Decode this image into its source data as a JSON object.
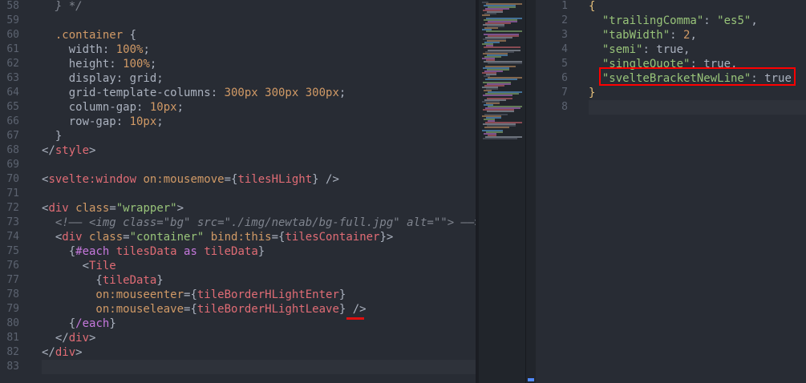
{
  "left_editor": {
    "lines": [
      {
        "n": "58",
        "segments": [
          {
            "t": "  } */",
            "c": "t-comment"
          }
        ]
      },
      {
        "n": "59",
        "segments": []
      },
      {
        "n": "60",
        "segments": [
          {
            "t": "  .container",
            "c": "t-cls"
          },
          {
            "t": " {",
            "c": "t-punct"
          }
        ]
      },
      {
        "n": "61",
        "segments": [
          {
            "t": "    width: ",
            "c": "t-prop"
          },
          {
            "t": "100%",
            "c": "t-num"
          },
          {
            "t": ";",
            "c": "t-punct"
          }
        ]
      },
      {
        "n": "62",
        "segments": [
          {
            "t": "    height: ",
            "c": "t-prop"
          },
          {
            "t": "100%",
            "c": "t-num"
          },
          {
            "t": ";",
            "c": "t-punct"
          }
        ]
      },
      {
        "n": "63",
        "segments": [
          {
            "t": "    display: grid;",
            "c": "t-prop"
          }
        ]
      },
      {
        "n": "64",
        "segments": [
          {
            "t": "    grid-template-columns: ",
            "c": "t-prop"
          },
          {
            "t": "300px 300px 300px",
            "c": "t-num"
          },
          {
            "t": ";",
            "c": "t-punct"
          }
        ]
      },
      {
        "n": "65",
        "segments": [
          {
            "t": "    column-gap: ",
            "c": "t-prop"
          },
          {
            "t": "10px",
            "c": "t-num"
          },
          {
            "t": ";",
            "c": "t-punct"
          }
        ]
      },
      {
        "n": "66",
        "segments": [
          {
            "t": "    row-gap: ",
            "c": "t-prop"
          },
          {
            "t": "10px",
            "c": "t-num"
          },
          {
            "t": ";",
            "c": "t-punct"
          }
        ]
      },
      {
        "n": "67",
        "segments": [
          {
            "t": "  }",
            "c": "t-punct"
          }
        ]
      },
      {
        "n": "68",
        "segments": [
          {
            "t": "</",
            "c": "t-punct"
          },
          {
            "t": "style",
            "c": "t-tag"
          },
          {
            "t": ">",
            "c": "t-punct"
          }
        ]
      },
      {
        "n": "69",
        "segments": []
      },
      {
        "n": "70",
        "segments": [
          {
            "t": "<",
            "c": "t-punct"
          },
          {
            "t": "svelte:window",
            "c": "t-tag"
          },
          {
            "t": " on:mousemove",
            "c": "t-attr"
          },
          {
            "t": "={",
            "c": "t-punct"
          },
          {
            "t": "tilesHLight",
            "c": "t-var"
          },
          {
            "t": "} />",
            "c": "t-punct"
          }
        ]
      },
      {
        "n": "71",
        "segments": []
      },
      {
        "n": "72",
        "segments": [
          {
            "t": "<",
            "c": "t-punct"
          },
          {
            "t": "div",
            "c": "t-tag"
          },
          {
            "t": " class",
            "c": "t-attr"
          },
          {
            "t": "=",
            "c": "t-punct"
          },
          {
            "t": "\"wrapper\"",
            "c": "t-str"
          },
          {
            "t": ">",
            "c": "t-punct"
          }
        ]
      },
      {
        "n": "73",
        "segments": [
          {
            "t": "  <!—— <img class=\"bg\" src=\"./img/newtab/bg-full.jpg\" alt=\"\"> ——>",
            "c": "t-comment"
          }
        ]
      },
      {
        "n": "74",
        "segments": [
          {
            "t": "  <",
            "c": "t-punct"
          },
          {
            "t": "div",
            "c": "t-tag"
          },
          {
            "t": " class",
            "c": "t-attr"
          },
          {
            "t": "=",
            "c": "t-punct"
          },
          {
            "t": "\"container\"",
            "c": "t-str"
          },
          {
            "t": " bind:this",
            "c": "t-attr"
          },
          {
            "t": "={",
            "c": "t-punct"
          },
          {
            "t": "tilesContainer",
            "c": "t-var"
          },
          {
            "t": "}>",
            "c": "t-punct"
          }
        ]
      },
      {
        "n": "75",
        "segments": [
          {
            "t": "    {",
            "c": "t-punct"
          },
          {
            "t": "#each",
            "c": "t-kw"
          },
          {
            "t": " tilesData ",
            "c": "t-var"
          },
          {
            "t": "as",
            "c": "t-kw"
          },
          {
            "t": " tileData",
            "c": "t-var"
          },
          {
            "t": "}",
            "c": "t-punct"
          }
        ]
      },
      {
        "n": "76",
        "segments": [
          {
            "t": "      <",
            "c": "t-punct"
          },
          {
            "t": "Tile",
            "c": "t-tag"
          }
        ]
      },
      {
        "n": "77",
        "segments": [
          {
            "t": "        {",
            "c": "t-punct"
          },
          {
            "t": "tileData",
            "c": "t-var"
          },
          {
            "t": "}",
            "c": "t-punct"
          }
        ]
      },
      {
        "n": "78",
        "segments": [
          {
            "t": "        on:mouseenter",
            "c": "t-attr"
          },
          {
            "t": "={",
            "c": "t-punct"
          },
          {
            "t": "tileBorderHLightEnter",
            "c": "t-var"
          },
          {
            "t": "}",
            "c": "t-punct"
          }
        ]
      },
      {
        "n": "79",
        "segments": [
          {
            "t": "        on:mouseleave",
            "c": "t-attr"
          },
          {
            "t": "={",
            "c": "t-punct"
          },
          {
            "t": "tileBorderHLightLeave",
            "c": "t-var"
          },
          {
            "t": "} />",
            "c": "t-punct"
          }
        ]
      },
      {
        "n": "80",
        "segments": [
          {
            "t": "    {",
            "c": "t-punct"
          },
          {
            "t": "/each",
            "c": "t-kw"
          },
          {
            "t": "}",
            "c": "t-punct"
          }
        ]
      },
      {
        "n": "81",
        "segments": [
          {
            "t": "  </",
            "c": "t-punct"
          },
          {
            "t": "div",
            "c": "t-tag"
          },
          {
            "t": ">",
            "c": "t-punct"
          }
        ]
      },
      {
        "n": "82",
        "segments": [
          {
            "t": "</",
            "c": "t-punct"
          },
          {
            "t": "div",
            "c": "t-tag"
          },
          {
            "t": ">",
            "c": "t-punct"
          }
        ]
      },
      {
        "n": "83",
        "segments": []
      }
    ],
    "current_line": "83"
  },
  "right_editor": {
    "lines": [
      {
        "n": "1",
        "segments": [
          {
            "t": "{",
            "c": "t-comp"
          }
        ]
      },
      {
        "n": "2",
        "segments": [
          {
            "t": "  ",
            "c": "t-punct"
          },
          {
            "t": "\"trailingComma\"",
            "c": "t-str"
          },
          {
            "t": ": ",
            "c": "t-punct"
          },
          {
            "t": "\"es5\"",
            "c": "t-str"
          },
          {
            "t": ",",
            "c": "t-punct"
          }
        ]
      },
      {
        "n": "3",
        "segments": [
          {
            "t": "  ",
            "c": "t-punct"
          },
          {
            "t": "\"tabWidth\"",
            "c": "t-str"
          },
          {
            "t": ": ",
            "c": "t-punct"
          },
          {
            "t": "2",
            "c": "t-num"
          },
          {
            "t": ",",
            "c": "t-punct"
          }
        ]
      },
      {
        "n": "4",
        "segments": [
          {
            "t": "  ",
            "c": "t-punct"
          },
          {
            "t": "\"semi\"",
            "c": "t-str"
          },
          {
            "t": ": true,",
            "c": "t-punct"
          }
        ]
      },
      {
        "n": "5",
        "segments": [
          {
            "t": "  ",
            "c": "t-punct"
          },
          {
            "t": "\"singleQuote\"",
            "c": "t-str"
          },
          {
            "t": ": true,",
            "c": "t-punct"
          }
        ]
      },
      {
        "n": "6",
        "segments": [
          {
            "t": "  ",
            "c": "t-punct"
          },
          {
            "t": "\"svelteBracketNewLine\"",
            "c": "t-str"
          },
          {
            "t": ": true",
            "c": "t-punct"
          }
        ]
      },
      {
        "n": "7",
        "segments": [
          {
            "t": "}",
            "c": "t-comp"
          }
        ]
      },
      {
        "n": "8",
        "segments": []
      }
    ],
    "current_line": "8"
  },
  "colors": {
    "background": "#282c34",
    "highlight_box": "#ff0000",
    "scroll_thumb": "#528bff"
  }
}
